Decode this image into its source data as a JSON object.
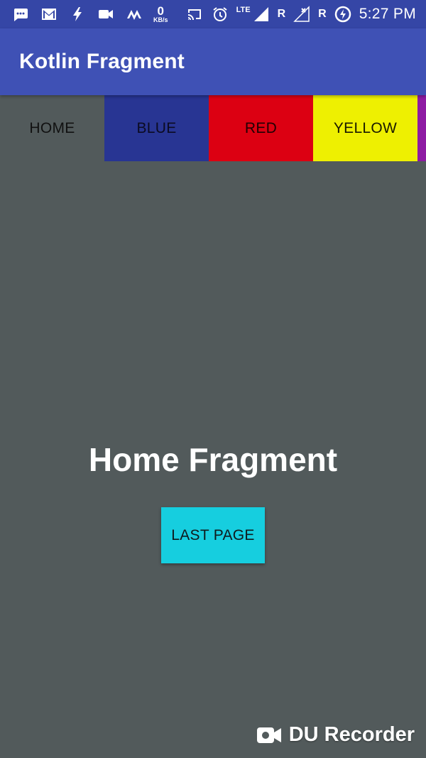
{
  "status_bar": {
    "net_speed_value": "0",
    "net_speed_unit": "KB/s",
    "network_type": "LTE",
    "roaming_1": "R",
    "roaming_2": "R",
    "time": "5:27 PM",
    "icons": [
      "chat-bubble-icon",
      "gmail-icon",
      "flash-icon",
      "video-camera-icon",
      "m-logo-icon",
      "cast-icon",
      "alarm-icon",
      "signal-icon",
      "signal-no-service-icon",
      "battery-charging-icon"
    ]
  },
  "app_bar": {
    "title": "Kotlin Fragment"
  },
  "tabs": [
    {
      "label": "HOME",
      "color": "#525a5b"
    },
    {
      "label": "BLUE",
      "color": "#283593"
    },
    {
      "label": "RED",
      "color": "#dc0012"
    },
    {
      "label": "YELLOW",
      "color": "#eef001"
    },
    {
      "label": "",
      "color": "#8e1ba3"
    }
  ],
  "main": {
    "title": "Home Fragment",
    "button_label": "LAST PAGE"
  },
  "watermark": {
    "text": "DU Recorder",
    "icon": "video-camera-icon"
  },
  "colors": {
    "status_bar": "#3546a6",
    "app_bar": "#3f51b5",
    "background": "#525a5b",
    "button": "#16cedf"
  }
}
